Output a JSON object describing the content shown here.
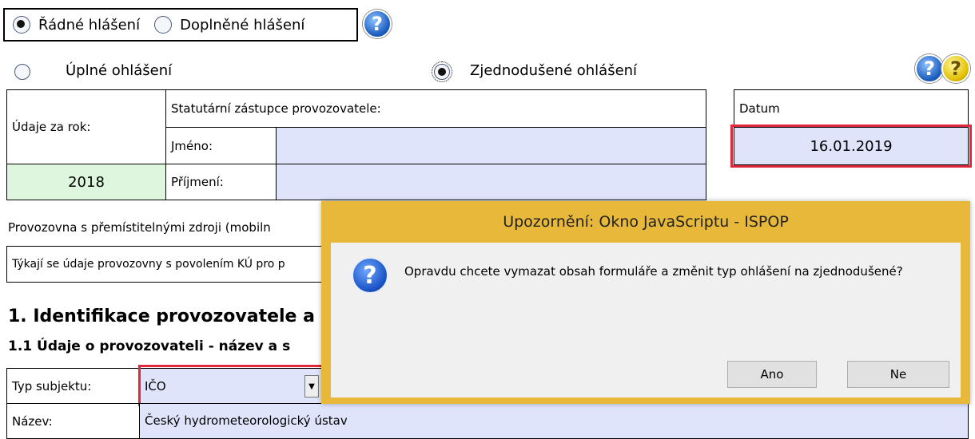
{
  "report_type": {
    "regular_label": "Řádné hlášení",
    "supplemental_label": "Doplněné hlášení",
    "selected": "regular"
  },
  "report_scope": {
    "full_label": "Úplné ohlášení",
    "simplified_label": "Zjednodušené ohlášení",
    "selected": "simplified"
  },
  "year_block": {
    "label": "Údaje za rok:",
    "value": "2018"
  },
  "representative": {
    "header": "Statutární zástupce provozovatele:",
    "first_name_label": "Jméno:",
    "first_name_value": "",
    "last_name_label": "Příjmení:",
    "last_name_value": ""
  },
  "date_block": {
    "label": "Datum",
    "value": "16.01.2019"
  },
  "mobile_sources": {
    "text": "Provozovna s přemístitelnými zdroji (mobiln",
    "kú_text": "Týkají se údaje provozovny s povolením KÚ pro p"
  },
  "section1": {
    "heading": "1. Identifikace provozovatele a",
    "subheading": "1.1 Údaje o provozovateli - název a s"
  },
  "subject": {
    "type_label": "Typ subjektu:",
    "type_value": "IČO",
    "name_label": "Název:",
    "name_value": "Český hydrometeorologický ústav"
  },
  "dialog": {
    "title": "Upozornění: Okno JavaScriptu - ISPOP",
    "message": "Opravdu chcete vymazat obsah formuláře a změnit typ ohlášení na zjednodušené?",
    "yes_label": "Ano",
    "no_label": "Ne"
  },
  "colors": {
    "input_fill": "#dfe4fb",
    "year_fill": "#ddf6dd",
    "highlight_border": "#e0283c",
    "dialog_border": "#e8b83a"
  },
  "icons": [
    "help-icon-blue",
    "help-icon-yellow",
    "question-icon"
  ]
}
